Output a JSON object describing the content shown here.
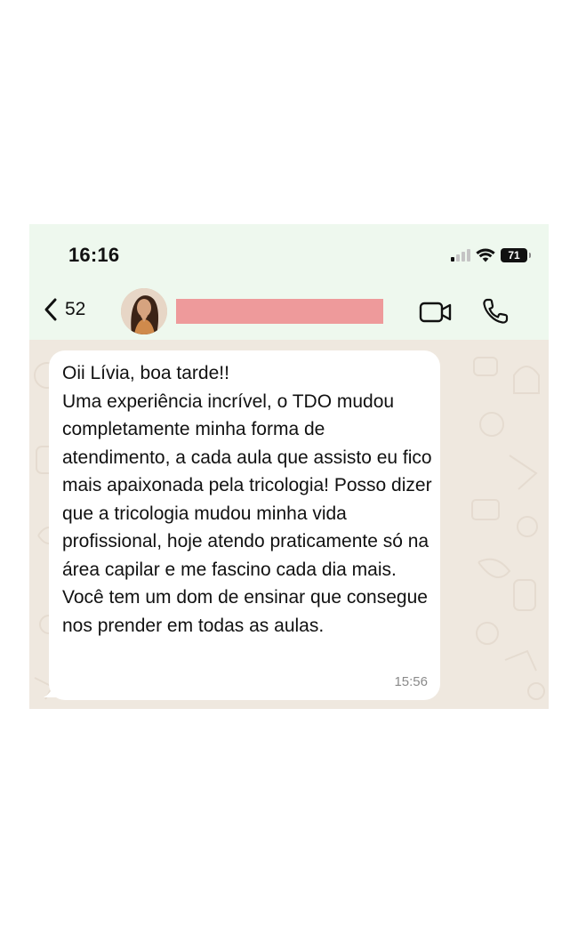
{
  "status_bar": {
    "time": "16:16",
    "battery_percent": "71",
    "signal_bars_active": 1,
    "signal_bars_total": 4
  },
  "chat_header": {
    "back_count": "52",
    "contact_name_redacted_color": "#ee9a9b",
    "icons": [
      "chevron-left-icon",
      "avatar",
      "video-camera-icon",
      "phone-icon"
    ]
  },
  "message": {
    "text": "Oii Lívia, boa tarde!!\nUma experiência incrível, o TDO mudou completamente minha forma de atendimento, a cada aula que assisto eu fico mais apaixonada pela tricologia! Posso dizer que a tricologia mudou minha vida profissional, hoje atendo praticamente só na área capilar e me fascino cada dia mais. Você tem um dom de ensinar que consegue nos prender em todas as aulas.",
    "time": "15:56"
  },
  "colors": {
    "header_background": "#eef8ee",
    "chat_background": "#efe8df",
    "bubble_background": "#ffffff"
  }
}
